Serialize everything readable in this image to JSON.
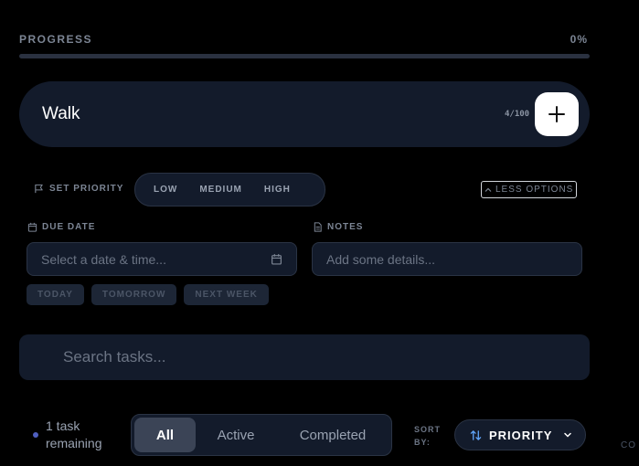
{
  "progress": {
    "label": "PROGRESS",
    "value_text": "0%",
    "fraction": 0
  },
  "task_input": {
    "value": "Walk",
    "char_count": "4/100"
  },
  "priority": {
    "label": "SET PRIORITY",
    "options": [
      "LOW",
      "MEDIUM",
      "HIGH"
    ],
    "less_options_label": "LESS OPTIONS"
  },
  "due_date": {
    "label": "DUE DATE",
    "placeholder": "Select a date & time...",
    "quick_options": [
      "TODAY",
      "TOMORROW",
      "NEXT WEEK"
    ]
  },
  "notes": {
    "label": "NOTES",
    "placeholder": "Add some details..."
  },
  "search": {
    "placeholder": "Search tasks..."
  },
  "footer": {
    "remaining_line1": "1 task",
    "remaining_line2": "remaining",
    "filters": [
      "All",
      "Active",
      "Completed"
    ],
    "sort_label": "SORT BY:",
    "sort_value": "PRIORITY",
    "edge_text": "CO"
  },
  "colors": {
    "accent": "#60a5fa",
    "background": "#000000",
    "panel": "#131b2b",
    "dot": "#4f5fbf"
  },
  "icons": [
    "flag-icon",
    "chevron-up-icon",
    "calendar-icon",
    "notes-icon",
    "plus-icon",
    "sort-arrows-icon",
    "chevron-down-icon"
  ]
}
